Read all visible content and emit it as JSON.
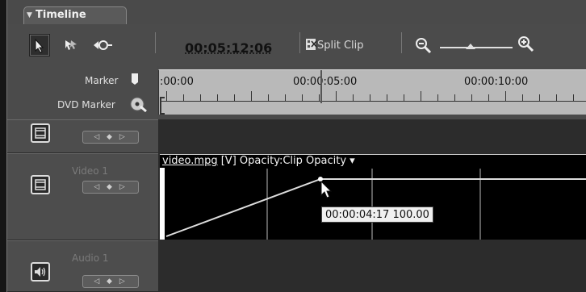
{
  "panel": {
    "tab_title": "Timeline"
  },
  "toolbar": {
    "timecode": "00:05:12:06",
    "split_clip_label": "Split Clip"
  },
  "ruler": {
    "marker_label": "Marker",
    "dvd_marker_label": "DVD Marker",
    "timecodes": [
      ":00:00",
      "00:00:05:00",
      "00:00:10:00"
    ]
  },
  "tracks": [
    {
      "name": "",
      "type": "video"
    },
    {
      "name": "Video 1",
      "type": "video"
    },
    {
      "name": "Audio 1",
      "type": "audio"
    }
  ],
  "clip": {
    "name": "video.mpg",
    "label_rest": " [V] Opacity:Clip Opacity ▾"
  },
  "keyframe_tooltip": "00:00:04:17 100.00",
  "icons": {
    "selection_tool": "arrow-cursor-icon",
    "track_select": "track-select-arrow-icon",
    "ripple": "ripple-edit-icon",
    "split": "scissors-film-icon",
    "zoom_out": "magnifier-minus-icon",
    "zoom_in": "magnifier-plus-icon",
    "marker": "marker-icon",
    "dvd_marker": "dvd-disc-icon",
    "video_track": "filmstrip-icon",
    "audio_track": "speaker-icon"
  },
  "zoom_level": 0.42
}
